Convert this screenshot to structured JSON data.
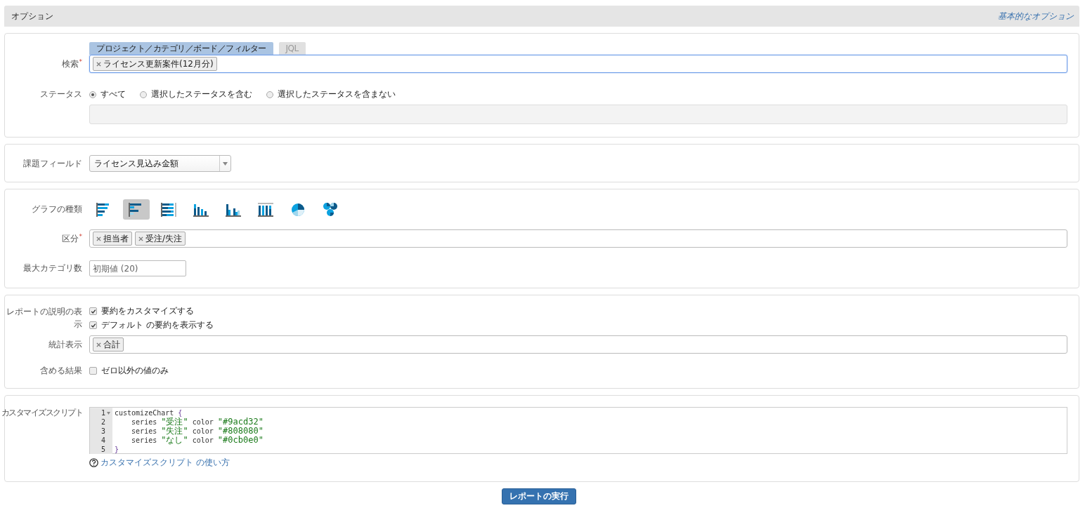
{
  "header": {
    "title": "オプション",
    "link": "基本的なオプション"
  },
  "search_panel": {
    "label": "検索",
    "required_mark": "*",
    "tabs": [
      {
        "label": "プロジェクト／カテゴリ／ボード／フィルター",
        "selected": true
      },
      {
        "label": "JQL",
        "selected": false
      }
    ],
    "tags": [
      "ライセンス更新案件(12月分)"
    ],
    "status_label": "ステータス",
    "status_options": [
      {
        "label": "すべて",
        "selected": true
      },
      {
        "label": "選択したステータスを含む",
        "selected": false
      },
      {
        "label": "選択したステータスを含まない",
        "selected": false
      }
    ]
  },
  "field_panel": {
    "label": "課題フィールド",
    "value": "ライセンス見込み金額"
  },
  "graph_panel": {
    "label": "グラフの種類",
    "chart_types": [
      {
        "kind": "bar-h",
        "selected": false
      },
      {
        "kind": "bar-h-grouped",
        "selected": true
      },
      {
        "kind": "bar-h-stacked",
        "selected": false
      },
      {
        "kind": "bar-v",
        "selected": false
      },
      {
        "kind": "bar-v-grouped",
        "selected": false
      },
      {
        "kind": "bar-v-stacked",
        "selected": false
      },
      {
        "kind": "pie",
        "selected": false
      },
      {
        "kind": "multi-pie",
        "selected": false
      }
    ],
    "group_label": "区分",
    "group_required_mark": "*",
    "group_tags": [
      "担当者",
      "受注/失注"
    ],
    "max_label": "最大カテゴリ数",
    "max_placeholder": "初期値 (20)"
  },
  "report_panel": {
    "desc_label": "レポートの説明の表示",
    "desc_options": [
      {
        "label": "要約をカスタマイズする",
        "checked": true
      },
      {
        "label": "デフォルト の要約を表示する",
        "checked": true
      }
    ],
    "stats_label": "統計表示",
    "stats_tags": [
      "合計"
    ],
    "result_label": "含める結果",
    "result_options": [
      {
        "label": "ゼロ以外の値のみ",
        "checked": false
      }
    ]
  },
  "script_panel": {
    "label": "カスタマイズスクリプト",
    "code_lines": [
      {
        "number": "1",
        "foldable": true,
        "tokens": [
          {
            "text": "customizeChart ",
            "kind": "plain"
          },
          {
            "text": "{",
            "kind": "brace"
          }
        ]
      },
      {
        "number": "2",
        "foldable": false,
        "tokens": [
          {
            "text": "    series ",
            "kind": "plain"
          },
          {
            "text": "\"受注\"",
            "kind": "string"
          },
          {
            "text": " color ",
            "kind": "plain"
          },
          {
            "text": "\"#9acd32\"",
            "kind": "string"
          }
        ]
      },
      {
        "number": "3",
        "foldable": false,
        "tokens": [
          {
            "text": "    series ",
            "kind": "plain"
          },
          {
            "text": "\"失注\"",
            "kind": "string"
          },
          {
            "text": " color ",
            "kind": "plain"
          },
          {
            "text": "\"#808080\"",
            "kind": "string"
          }
        ]
      },
      {
        "number": "4",
        "foldable": false,
        "tokens": [
          {
            "text": "    series ",
            "kind": "plain"
          },
          {
            "text": "\"なし\"",
            "kind": "string"
          },
          {
            "text": " color ",
            "kind": "plain"
          },
          {
            "text": "\"#0cb0e0\"",
            "kind": "string"
          }
        ]
      },
      {
        "number": "5",
        "foldable": false,
        "tokens": [
          {
            "text": "}",
            "kind": "brace"
          }
        ]
      }
    ],
    "help_link": "カスタマイズスクリプト の使い方"
  },
  "run_button": "レポートの実行"
}
